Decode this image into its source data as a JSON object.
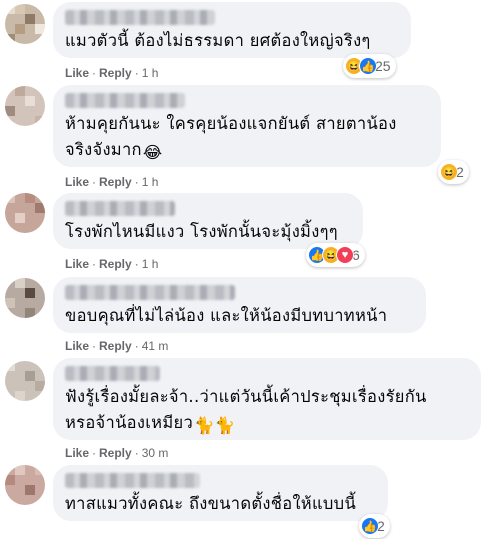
{
  "comments": [
    {
      "text_lines": [
        "แมวตัวนี้ ต้องไม่ธรรมดา ยศต้องใหญ่จริงๆ"
      ],
      "actions": {
        "like": "Like",
        "reply": "Reply",
        "time": "1 h"
      },
      "reactions": {
        "icons": [
          "haha-icon",
          "like-icon"
        ],
        "count": "25"
      }
    },
    {
      "text_lines": [
        "ห้ามคุยกันนะ ใครคุยน้องแจกยันต์ สายตาน้อง",
        "จริงจังมาก"
      ],
      "inline_emoji": "haha-emoji",
      "actions": {
        "like": "Like",
        "reply": "Reply",
        "time": "1 h"
      },
      "reactions": {
        "icons": [
          "haha-icon"
        ],
        "count": "2"
      }
    },
    {
      "text_lines": [
        "โรงพักไหนมีแงว โรงพักนั้นจะมุ้งมิ้งๆๆ"
      ],
      "actions": {
        "like": "Like",
        "reply": "Reply",
        "time": "1 h"
      },
      "reactions": {
        "icons": [
          "like-icon",
          "haha-icon",
          "love-icon"
        ],
        "count": "6"
      }
    },
    {
      "text_lines": [
        "ขอบคุณที่ไม่ไล่น้อง และให้น้องมีบทบาทหน้า"
      ],
      "actions": {
        "like": "Like",
        "reply": "Reply",
        "time": "41 m"
      },
      "reactions": null
    },
    {
      "text_lines": [
        "ฟังรู้เรื่องมั้ยละจ้า..ว่าแต่วันนี้เค้าประชุมเรื่องรัยกัน",
        "หรอจ้าน้องเหมียว"
      ],
      "inline_emoji": "cat-emoji",
      "actions": {
        "like": "Like",
        "reply": "Reply",
        "time": "30 m"
      },
      "reactions": null
    },
    {
      "text_lines": [
        "ทาสแมวทั้งคณะ ถึงขนาดตั้งชื่อให้แบบนี้"
      ],
      "actions": {
        "like": "Like",
        "reply": "Reply",
        "time": ""
      },
      "reactions": {
        "icons": [
          "like-icon"
        ],
        "count": "2"
      }
    }
  ],
  "colors": {
    "bubble": "#f0f2f5",
    "meta_text": "#65676b",
    "like_blue": "#1877f2",
    "haha_yellow": "#f7b125",
    "love_red": "#f33e58"
  }
}
